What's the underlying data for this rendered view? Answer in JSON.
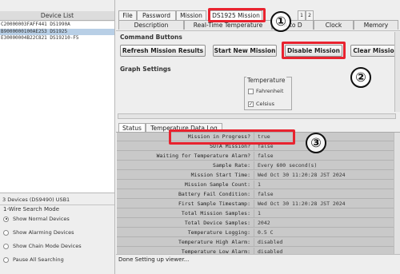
{
  "device_list": {
    "header": "Device List",
    "items": [
      {
        "label": "C20000003FAFF441 DS1990A",
        "selected": false
      },
      {
        "label": "B9000000100AE253 DS1925",
        "selected": true
      },
      {
        "label": "E30000004B22C821 DS19210-F5",
        "selected": false
      }
    ],
    "count": "3 Devices  (DS9490) USB1"
  },
  "search_mode": {
    "title": "1-Wire Search Mode",
    "options": [
      {
        "label": "Show Normal Devices",
        "selected": true
      },
      {
        "label": "Show Alarming Devices",
        "selected": false
      },
      {
        "label": "Show Chain Mode Devices",
        "selected": false
      },
      {
        "label": "Pause All Searching",
        "selected": false
      }
    ]
  },
  "tabs_row1": [
    "File",
    "Password",
    "Mission",
    "DS1925 Mission"
  ],
  "tabs_row1_right": [
    "1",
    "2"
  ],
  "tabs_row2": [
    "Description",
    "Real-Time Temperature",
    "A to D",
    "Clock",
    "Memory"
  ],
  "command_buttons": {
    "header": "Command Buttons",
    "refresh": "Refresh Mission Results",
    "start": "Start New Mission",
    "disable": "Disable Mission",
    "clear": "Clear Missio"
  },
  "graph_settings": {
    "header": "Graph Settings",
    "temperature_title": "Temperature",
    "fahrenheit": "Fahrenheit",
    "celsius": "Celsius",
    "celsius_checked": true,
    "fahrenheit_checked": false
  },
  "lower_tabs": [
    "Status",
    "Temperature Data Log"
  ],
  "status_rows": [
    {
      "label": "Mission in Progress?",
      "value": "true"
    },
    {
      "label": "SUTA Mission?",
      "value": "false"
    },
    {
      "label": "Waiting for Temperature Alarm?",
      "value": "false"
    },
    {
      "label": "Sample Rate:",
      "value": "Every 600 second(s)"
    },
    {
      "label": "Mission Start Time:",
      "value": "Wed Oct 30 11:20:28 JST 2024"
    },
    {
      "label": "Mission Sample Count:",
      "value": "1"
    },
    {
      "label": "Battery Fail Condition:",
      "value": "false"
    },
    {
      "label": "First Sample Timestamp:",
      "value": "Wed Oct 30 11:20:28 JST 2024"
    },
    {
      "label": "Total Mission Samples:",
      "value": "1"
    },
    {
      "label": "Total Device Samples:",
      "value": "2042"
    },
    {
      "label": "Temperature Logging:",
      "value": "0.5 C"
    },
    {
      "label": "Temperature High Alarm:",
      "value": "disabled"
    },
    {
      "label": "Temperature Low Alarm:",
      "value": "disabled"
    }
  ],
  "status_bar": "Done Setting up viewer...",
  "badges": [
    "①",
    "②",
    "③"
  ],
  "colors": {
    "highlight": "#e8232f",
    "selection": "#b8cfe6"
  }
}
